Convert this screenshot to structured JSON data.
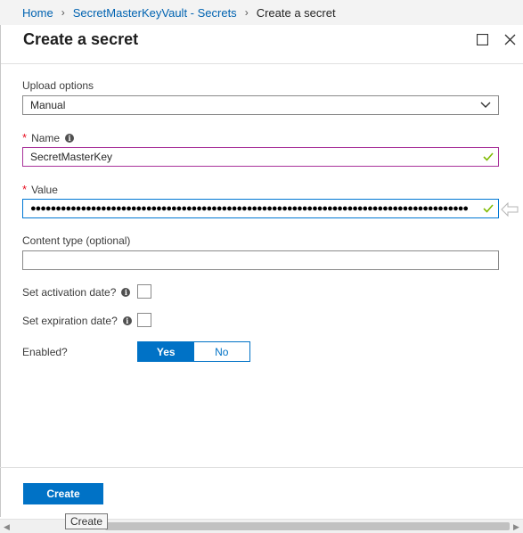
{
  "breadcrumb": {
    "items": [
      "Home",
      "SecretMasterKeyVault - Secrets"
    ],
    "current": "Create a secret",
    "separator": "›"
  },
  "blade": {
    "title": "Create a secret",
    "maximize_icon": "maximize-icon",
    "close_icon": "close-icon"
  },
  "form": {
    "upload_options": {
      "label": "Upload options",
      "value": "Manual"
    },
    "name": {
      "required_mark": "*",
      "label": "Name",
      "value": "SecretMasterKey",
      "info_glyph": "i"
    },
    "value": {
      "required_mark": "*",
      "label": "Value",
      "masked": "●●●●●●●●●●●●●●●●●●●●●●●●●●●●●●●●●●●●●●●●●●●●●●●●●●●●●●●●●●●●●●●●●●●●●●●●●●●●●●●●●●●●●●●"
    },
    "content_type": {
      "label": "Content type (optional)",
      "value": ""
    },
    "activation": {
      "label": "Set activation date?",
      "info_glyph": "i",
      "checked": false
    },
    "expiration": {
      "label": "Set expiration date?",
      "info_glyph": "i",
      "checked": false
    },
    "enabled": {
      "label": "Enabled?",
      "yes": "Yes",
      "no": "No",
      "selected": "Yes"
    }
  },
  "footer": {
    "create_label": "Create",
    "tooltip": "Create"
  },
  "colors": {
    "accent": "#0072c6",
    "link": "#0063b1",
    "required": "#e81123",
    "valid_check": "#7fba00",
    "name_border": "#a8329a"
  }
}
